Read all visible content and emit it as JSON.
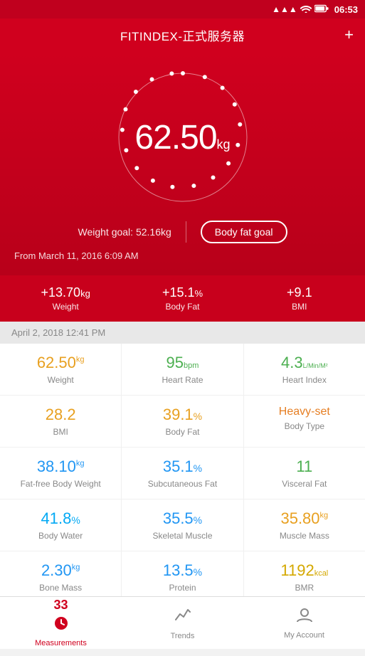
{
  "statusBar": {
    "time": "06:53",
    "icons": [
      "signal",
      "wifi",
      "battery"
    ]
  },
  "header": {
    "title": "FITINDEX-正式服务器",
    "addButton": "+"
  },
  "hero": {
    "weightValue": "62.50",
    "weightUnit": "kg",
    "goalLabel": "Weight goal: 52.16kg",
    "bodyFatGoalBtn": "Body fat goal",
    "fromDate": "From March 11, 2016 6:09 AM"
  },
  "statsBar": {
    "items": [
      {
        "change": "+13.70",
        "unit": "kg",
        "label": "Weight"
      },
      {
        "change": "+15.1",
        "unit": "%",
        "label": "Body Fat"
      },
      {
        "change": "+9.1",
        "unit": "",
        "label": "BMI"
      }
    ]
  },
  "recordDate": "April 2, 2018 12:41 PM",
  "metrics": {
    "rows": [
      [
        {
          "value": "62.50",
          "unit": "kg",
          "label": "Weight",
          "color": "color-orange"
        },
        {
          "value": "95",
          "unitBpm": "bpm",
          "label": "Heart Rate",
          "color": "color-green"
        },
        {
          "value": "4.3",
          "unitSub": "L/Min/M²",
          "label": "Heart Index",
          "color": "color-green"
        }
      ],
      [
        {
          "value": "28.2",
          "unit": "",
          "label": "BMI",
          "color": "color-orange"
        },
        {
          "value": "39.1",
          "unit": "%",
          "label": "Body Fat",
          "color": "color-orange"
        },
        {
          "value": "Heavy-set",
          "unit": "",
          "label": "Body Type",
          "color": "color-heavy",
          "isText": true
        }
      ],
      [
        {
          "value": "38.10",
          "unit": "kg",
          "label": "Fat-free Body Weight",
          "color": "color-blue"
        },
        {
          "value": "35.1",
          "unit": "%",
          "label": "Subcutaneous Fat",
          "color": "color-blue"
        },
        {
          "value": "11",
          "unit": "",
          "label": "Visceral Fat",
          "color": "color-green"
        }
      ],
      [
        {
          "value": "41.8",
          "unit": "%",
          "label": "Body Water",
          "color": "color-light-blue"
        },
        {
          "value": "35.5",
          "unit": "%",
          "label": "Skeletal Muscle",
          "color": "color-blue"
        },
        {
          "value": "35.80",
          "unit": "kg",
          "label": "Muscle Mass",
          "color": "color-orange"
        }
      ],
      [
        {
          "value": "2.30",
          "unit": "kg",
          "label": "Bone Mass",
          "color": "color-blue"
        },
        {
          "value": "13.5",
          "unit": "%",
          "label": "Protein",
          "color": "color-blue"
        },
        {
          "value": "1192",
          "unitSub": "kcal",
          "label": "BMR",
          "color": "color-yellow"
        }
      ]
    ]
  },
  "bottomNav": {
    "items": [
      {
        "id": "measurements",
        "badge": "33",
        "label": "Measurements",
        "active": true
      },
      {
        "id": "trends",
        "icon": "📈",
        "label": "Trends",
        "active": false
      },
      {
        "id": "account",
        "icon": "👤",
        "label": "My Account",
        "active": false
      }
    ]
  }
}
